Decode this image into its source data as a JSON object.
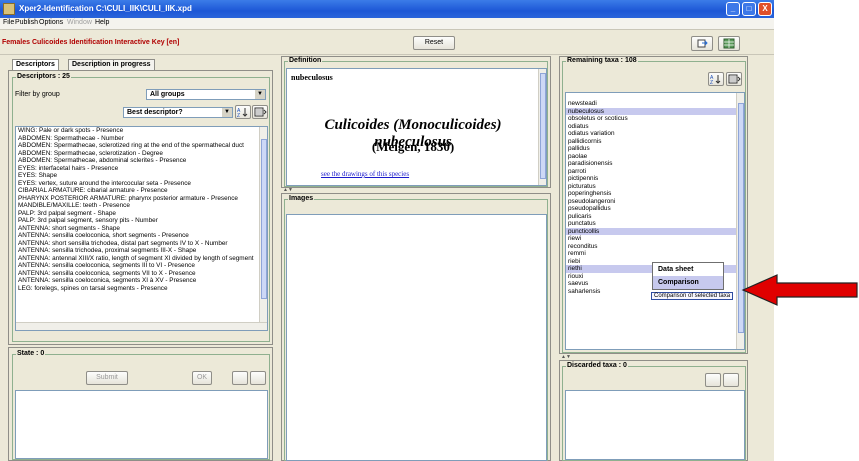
{
  "window": {
    "title": "Xper2-Identification    C:\\CULI_IIK\\CULI_IIK.xpd",
    "buttons": [
      "_",
      "□",
      "X"
    ]
  },
  "menubar": {
    "items": [
      {
        "label": "File",
        "enabled": true
      },
      {
        "label": "Publish",
        "enabled": true
      },
      {
        "label": "Options",
        "enabled": true
      },
      {
        "label": "Window",
        "enabled": false
      },
      {
        "label": "Help",
        "enabled": true
      }
    ]
  },
  "keybar": {
    "title": "Females Culicoides Identification Interactive Key [en]",
    "reset_label": "Reset"
  },
  "tabs": [
    "Descriptors",
    "Description in progress"
  ],
  "descriptors": {
    "title": "Descriptors : 25",
    "filter_label": "Filter by group",
    "filter_value": "All groups",
    "best_value": "Best descriptor?",
    "items": [
      "WING: Pale or dark spots - Presence",
      "ABDOMEN: Spermathecae - Number",
      "ABDOMEN: Spermathecae, sclerotized ring at the end of the spermathecal duct",
      "ABDOMEN: Spermathecae, sclerotization - Degree",
      "ABDOMEN: Spermathecae, abdominal sclerites - Presence",
      "EYES: interfacetal hairs - Presence",
      "EYES: Shape",
      "EYES: vertex, suture around the intercocular seta - Presence",
      "CIBARIAL ARMATURE: cibarial armature - Presence",
      "PHARYNX POSTERIOR ARMATURE: pharynx posterior armature - Presence",
      "MANDIBLE/MAXILLE: teeth - Presence",
      "PALP: 3rd palpal segment - Shape",
      "PALP: 3rd palpal segment, sensory pits - Number",
      "ANTENNA: short segments - Shape",
      "ANTENNA: sensilla coeloconica, short segments - Presence",
      "ANTENNA: short sensilla trichodea, distal part segments IV to X - Number",
      "ANTENNA: sensilla trichodea, proximal segments III-X - Shape",
      "ANTENNA: antennal XIII/X ratio, length of segment XI divided by length of segment",
      "ANTENNA: sensilla coeloconica, segments III to VI - Presence",
      "ANTENNA: sensilla coeloconica, segments VII to X - Presence",
      "ANTENNA: sensilla coeloconica, segments XI à XV - Presence",
      "LEG: forelegs, spines on tarsal segments - Presence"
    ]
  },
  "states": {
    "title": "State : 0",
    "submit_label": "Submit",
    "ok_label": "OK"
  },
  "definition": {
    "title": "Definition",
    "name": "nubeculosus",
    "species_name": "Culicoides (Monoculicoides) nubeculosus",
    "author": "(Meigen, 1830)",
    "link_text": "see the drawings of this species"
  },
  "images": {
    "title": "Images"
  },
  "remaining": {
    "title": "Remaining taxa : 108",
    "items": [
      {
        "label": "newsteadi",
        "selected": false
      },
      {
        "label": "nubeculosus",
        "selected": true
      },
      {
        "label": "obsoletus or scoticus",
        "selected": false
      },
      {
        "label": "odiatus",
        "selected": false
      },
      {
        "label": "odiatus variation",
        "selected": false
      },
      {
        "label": "pallidicornis",
        "selected": false
      },
      {
        "label": "pallidus",
        "selected": false
      },
      {
        "label": "paolae",
        "selected": false
      },
      {
        "label": "paradisionensis",
        "selected": false
      },
      {
        "label": "parroti",
        "selected": false
      },
      {
        "label": "pictipennis",
        "selected": false
      },
      {
        "label": "picturatus",
        "selected": false
      },
      {
        "label": "poperinghensis",
        "selected": false
      },
      {
        "label": "pseudolangeroni",
        "selected": false
      },
      {
        "label": "pseudopallidus",
        "selected": false
      },
      {
        "label": "pulicaris",
        "selected": false
      },
      {
        "label": "punctatus",
        "selected": false
      },
      {
        "label": "puncticollis",
        "selected": true
      },
      {
        "label": "riewi",
        "selected": false
      },
      {
        "label": "reconditus",
        "selected": false
      },
      {
        "label": "remmi",
        "selected": false
      },
      {
        "label": "riebi",
        "selected": false
      },
      {
        "label": "riethi",
        "selected": true
      },
      {
        "label": "riouxi",
        "selected": false
      },
      {
        "label": "saevus",
        "selected": false
      },
      {
        "label": "saharlensis",
        "selected": false
      }
    ]
  },
  "discarded": {
    "title": "Discarded taxa : 0"
  },
  "context_menu": {
    "items": [
      {
        "label": "Data sheet",
        "active": false
      },
      {
        "label": "Comparison",
        "active": true
      }
    ],
    "tooltip": "Comparison of selected taxa"
  },
  "colors": {
    "title_red": "#b00000",
    "selection": "#c7c9ee",
    "arrow_red": "#e00000"
  }
}
